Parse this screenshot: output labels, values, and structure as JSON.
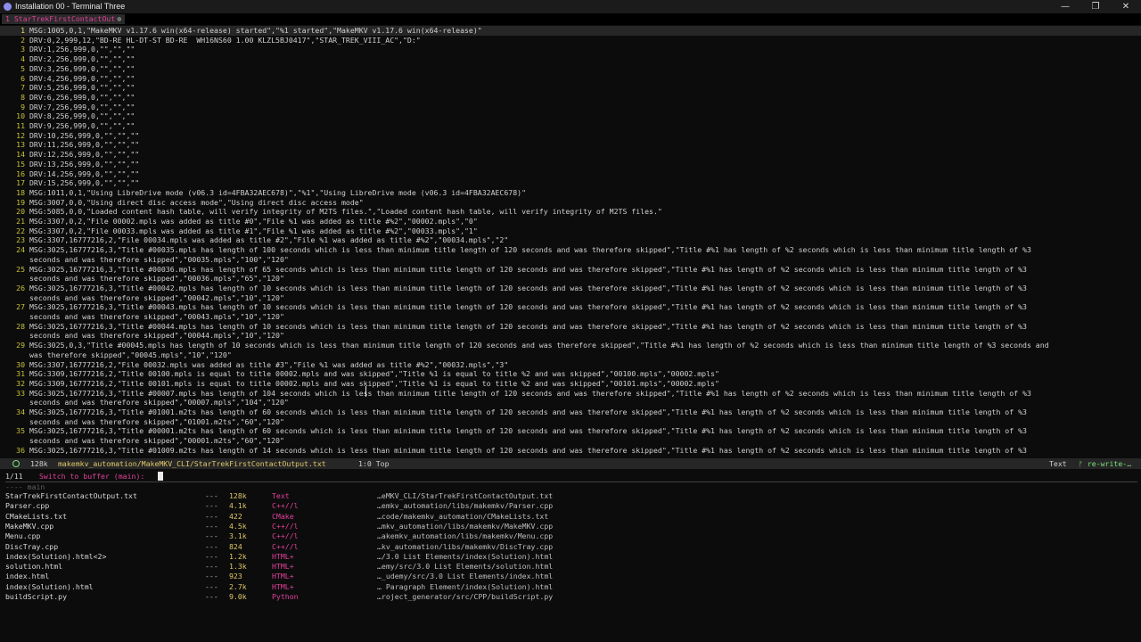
{
  "window": {
    "title": "Installation 00 - Terminal Three",
    "minimize": "—",
    "restore": "❐",
    "close": "✕"
  },
  "tab": {
    "label": "1 StarTrekFirstContactOut",
    "close": "⊗"
  },
  "editor": {
    "current_line": 1,
    "lines": [
      {
        "n": "1",
        "t": "MSG:1005,0,1,\"MakeMKV v1.17.6 win(x64-release) started\",\"%1 started\",\"MakeMKV v1.17.6 win(x64-release)\""
      },
      {
        "n": "2",
        "t": "DRV:0,2,999,12,\"BD-RE HL-DT-ST BD-RE  WH16NS60 1.00 KLZL5BJ0417\",\"STAR_TREK_VIII_AC\",\"D:\""
      },
      {
        "n": "3",
        "t": "DRV:1,256,999,0,\"\",\"\",\"\""
      },
      {
        "n": "4",
        "t": "DRV:2,256,999,0,\"\",\"\",\"\""
      },
      {
        "n": "5",
        "t": "DRV:3,256,999,0,\"\",\"\",\"\""
      },
      {
        "n": "6",
        "t": "DRV:4,256,999,0,\"\",\"\",\"\""
      },
      {
        "n": "7",
        "t": "DRV:5,256,999,0,\"\",\"\",\"\""
      },
      {
        "n": "8",
        "t": "DRV:6,256,999,0,\"\",\"\",\"\""
      },
      {
        "n": "9",
        "t": "DRV:7,256,999,0,\"\",\"\",\"\""
      },
      {
        "n": "10",
        "t": "DRV:8,256,999,0,\"\",\"\",\"\""
      },
      {
        "n": "11",
        "t": "DRV:9,256,999,0,\"\",\"\",\"\""
      },
      {
        "n": "12",
        "t": "DRV:10,256,999,0,\"\",\"\",\"\""
      },
      {
        "n": "13",
        "t": "DRV:11,256,999,0,\"\",\"\",\"\""
      },
      {
        "n": "14",
        "t": "DRV:12,256,999,0,\"\",\"\",\"\""
      },
      {
        "n": "15",
        "t": "DRV:13,256,999,0,\"\",\"\",\"\""
      },
      {
        "n": "16",
        "t": "DRV:14,256,999,0,\"\",\"\",\"\""
      },
      {
        "n": "17",
        "t": "DRV:15,256,999,0,\"\",\"\",\"\""
      },
      {
        "n": "18",
        "t": "MSG:1011,0,1,\"Using LibreDrive mode (v06.3 id=4FBA32AEC678)\",\"%1\",\"Using LibreDrive mode (v06.3 id=4FBA32AEC678)\""
      },
      {
        "n": "19",
        "t": "MSG:3007,0,0,\"Using direct disc access mode\",\"Using direct disc access mode\""
      },
      {
        "n": "20",
        "t": "MSG:5085,0,0,\"Loaded content hash table, will verify integrity of M2TS files.\",\"Loaded content hash table, will verify integrity of M2TS files.\""
      },
      {
        "n": "21",
        "t": "MSG:3307,0,2,\"File 00002.mpls was added as title #0\",\"File %1 was added as title #%2\",\"00002.mpls\",\"0\""
      },
      {
        "n": "22",
        "t": "MSG:3307,0,2,\"File 00033.mpls was added as title #1\",\"File %1 was added as title #%2\",\"00033.mpls\",\"1\""
      },
      {
        "n": "23",
        "t": "MSG:3307,16777216,2,\"File 00034.mpls was added as title #2\",\"File %1 was added as title #%2\",\"00034.mpls\",\"2\""
      },
      {
        "n": "24",
        "t": "MSG:3025,16777216,3,\"Title #00035.mpls has length of 100 seconds which is less than minimum title length of 120 seconds and was therefore skipped\",\"Title #%1 has length of %2 seconds which is less than minimum title length of %3"
      },
      {
        "n": "",
        "t": "seconds and was therefore skipped\",\"00035.mpls\",\"100\",\"120\""
      },
      {
        "n": "25",
        "t": "MSG:3025,16777216,3,\"Title #00036.mpls has length of 65 seconds which is less than minimum title length of 120 seconds and was therefore skipped\",\"Title #%1 has length of %2 seconds which is less than minimum title length of %3"
      },
      {
        "n": "",
        "t": "seconds and was therefore skipped\",\"00036.mpls\",\"65\",\"120\""
      },
      {
        "n": "26",
        "t": "MSG:3025,16777216,3,\"Title #00042.mpls has length of 10 seconds which is less than minimum title length of 120 seconds and was therefore skipped\",\"Title #%1 has length of %2 seconds which is less than minimum title length of %3"
      },
      {
        "n": "",
        "t": "seconds and was therefore skipped\",\"00042.mpls\",\"10\",\"120\""
      },
      {
        "n": "27",
        "t": "MSG:3025,16777216,3,\"Title #00043.mpls has length of 10 seconds which is less than minimum title length of 120 seconds and was therefore skipped\",\"Title #%1 has length of %2 seconds which is less than minimum title length of %3"
      },
      {
        "n": "",
        "t": "seconds and was therefore skipped\",\"00043.mpls\",\"10\",\"120\""
      },
      {
        "n": "28",
        "t": "MSG:3025,16777216,3,\"Title #00044.mpls has length of 10 seconds which is less than minimum title length of 120 seconds and was therefore skipped\",\"Title #%1 has length of %2 seconds which is less than minimum title length of %3"
      },
      {
        "n": "",
        "t": "seconds and was therefore skipped\",\"00044.mpls\",\"10\",\"120\""
      },
      {
        "n": "29",
        "t": "MSG:3025,0,3,\"Title #00045.mpls has length of 10 seconds which is less than minimum title length of 120 seconds and was therefore skipped\",\"Title #%1 has length of %2 seconds which is less than minimum title length of %3 seconds and"
      },
      {
        "n": "",
        "t": "was therefore skipped\",\"00045.mpls\",\"10\",\"120\""
      },
      {
        "n": "30",
        "t": "MSG:3307,16777216,2,\"File 00032.mpls was added as title #3\",\"File %1 was added as title #%2\",\"00032.mpls\",\"3\""
      },
      {
        "n": "31",
        "t": "MSG:3309,16777216,2,\"Title 00100.mpls is equal to title 00002.mpls and was skipped\",\"Title %1 is equal to title %2 and was skipped\",\"00100.mpls\",\"00002.mpls\""
      },
      {
        "n": "32",
        "t": "MSG:3309,16777216,2,\"Title 00101.mpls is equal to title 00002.mpls and was skipped\",\"Title %1 is equal to title %2 and was skipped\",\"00101.mpls\",\"00002.mpls\""
      },
      {
        "n": "33",
        "t": "MSG:3025,16777216,3,\"Title #00007.mpls has length of 104 seconds which is less than minimum title length of 120 seconds and was therefore skipped\",\"Title #%1 has length of %2 seconds which is less than minimum title length of %3"
      },
      {
        "n": "",
        "t": "seconds and was therefore skipped\",\"00007.mpls\",\"104\",\"120\""
      },
      {
        "n": "34",
        "t": "MSG:3025,16777216,3,\"Title #01001.m2ts has length of 60 seconds which is less than minimum title length of 120 seconds and was therefore skipped\",\"Title #%1 has length of %2 seconds which is less than minimum title length of %3"
      },
      {
        "n": "",
        "t": "seconds and was therefore skipped\",\"01001.m2ts\",\"60\",\"120\""
      },
      {
        "n": "35",
        "t": "MSG:3025,16777216,3,\"Title #00001.m2ts has length of 60 seconds which is less than minimum title length of 120 seconds and was therefore skipped\",\"Title #%1 has length of %2 seconds which is less than minimum title length of %3"
      },
      {
        "n": "",
        "t": "seconds and was therefore skipped\",\"00001.m2ts\",\"60\",\"120\""
      },
      {
        "n": "36",
        "t": "MSG:3025,16777216,3,\"Title #01009.m2ts has length of 14 seconds which is less than minimum title length of 120 seconds and was therefore skipped\",\"Title #%1 has length of %2 seconds which is less than minimum title length of %3"
      }
    ]
  },
  "modeline": {
    "size": "128k",
    "path": "makemkv_automation/MakeMKV_CLI/StarTrekFirstContactOutput.txt",
    "position": "1:0 Top",
    "mode": "Text",
    "status": "re-write-…"
  },
  "minibuffer": {
    "count": "1/11",
    "prompt": "Switch to buffer (main):"
  },
  "buffer_group": "---- main ",
  "buffers": [
    {
      "name": "StarTrekFirstContactOutput.txt",
      "dash": "---",
      "size": "128k",
      "mode": "Text",
      "path": "…eMKV_CLI/StarTrekFirstContactOutput.txt"
    },
    {
      "name": "Parser.cpp",
      "dash": "---",
      "size": "4.1k",
      "mode": "C++//l",
      "path": "…emkv_automation/libs/makemkv/Parser.cpp"
    },
    {
      "name": "CMakeLists.txt",
      "dash": "---",
      "size": "422",
      "mode": "CMake",
      "path": "…code/makemkv_automation/CMakeLists.txt"
    },
    {
      "name": "MakeMKV.cpp",
      "dash": "---",
      "size": "4.5k",
      "mode": "C++//l",
      "path": "…mkv_automation/libs/makemkv/MakeMKV.cpp"
    },
    {
      "name": "Menu.cpp",
      "dash": "---",
      "size": "3.1k",
      "mode": "C++//l",
      "path": "…akemkv_automation/libs/makemkv/Menu.cpp"
    },
    {
      "name": "DiscTray.cpp",
      "dash": "---",
      "size": "824",
      "mode": "C++//l",
      "path": "…kv_automation/libs/makemkv/DiscTray.cpp"
    },
    {
      "name": "index(Solution).html<2>",
      "dash": "---",
      "size": "1.2k",
      "mode": "HTML+",
      "path": "…/3.0 List Elements/index(Solution).html"
    },
    {
      "name": "solution.html",
      "dash": "---",
      "size": "1.3k",
      "mode": "HTML+",
      "path": "…emy/src/3.0 List Elements/solution.html"
    },
    {
      "name": "index.html",
      "dash": "---",
      "size": "923",
      "mode": "HTML+",
      "path": "…_udemy/src/3.0 List Elements/index.html"
    },
    {
      "name": "index(Solution).html",
      "dash": "---",
      "size": "2.7k",
      "mode": "HTML+",
      "path": "… Paragraph Element/index(Solution).html"
    },
    {
      "name": "buildScript.py",
      "dash": "---",
      "size": "9.0k",
      "mode": "Python",
      "path": "…roject_generator/src/CPP/buildScript.py"
    }
  ]
}
